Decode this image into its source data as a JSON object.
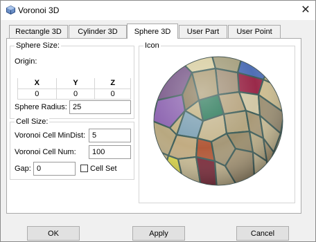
{
  "window": {
    "title": "Voronoi 3D",
    "close_glyph": "✕"
  },
  "tabs": [
    {
      "label": "Rectangle 3D",
      "active": false
    },
    {
      "label": "Cylinder 3D",
      "active": false
    },
    {
      "label": "Sphere 3D",
      "active": true
    },
    {
      "label": "User Part",
      "active": false
    },
    {
      "label": "User Point",
      "active": false
    }
  ],
  "sphere_size": {
    "group_label": "Sphere Size:",
    "origin_label": "Origin:",
    "columns": [
      "X",
      "Y",
      "Z"
    ],
    "values": [
      "0",
      "0",
      "0"
    ],
    "radius_label": "Sphere Radius:",
    "radius_value": "25"
  },
  "cell_size": {
    "group_label": "Cell Size:",
    "min_dist_label": "Voronoi Cell MinDist:",
    "min_dist_value": "5",
    "num_label": "Voronoi Cell Num:",
    "num_value": "100",
    "gap_label": "Gap:",
    "gap_value": "0",
    "cell_set_label": "Cell Set",
    "cell_set_checked": false
  },
  "preview": {
    "group_label": "Icon",
    "image": "voronoi-sphere-preview"
  },
  "buttons": {
    "ok": "OK",
    "apply": "Apply",
    "cancel": "Cancel"
  }
}
